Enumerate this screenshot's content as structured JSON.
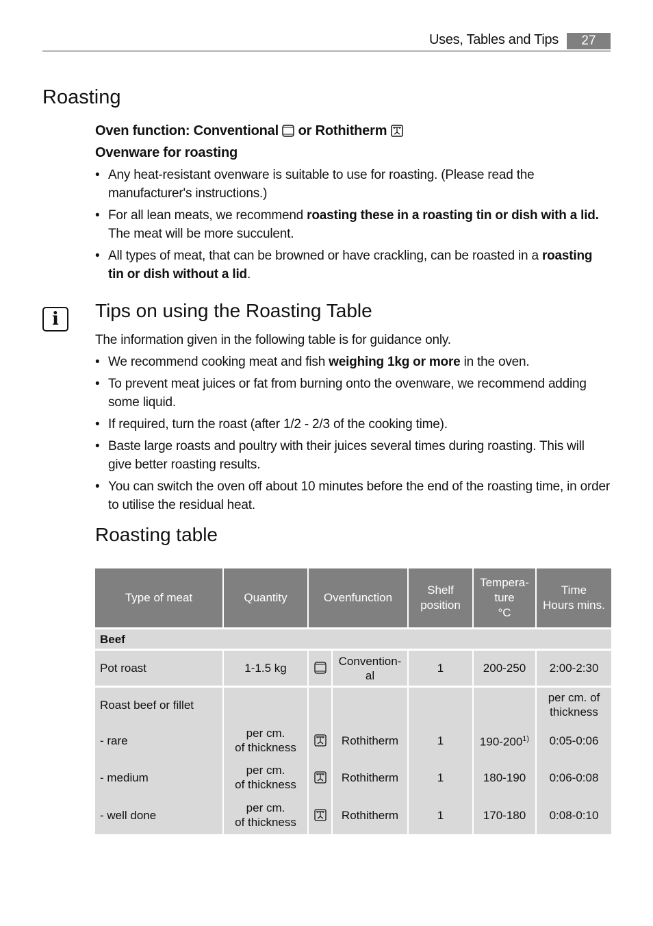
{
  "header": {
    "section": "Uses, Tables and Tips",
    "page": "27"
  },
  "roasting": {
    "title": "Roasting",
    "oven_function_prefix": "Oven function: Conventional",
    "oven_function_or": "or Rothitherm",
    "ovenware_title": "Ovenware for roasting",
    "b1": "Any heat-resistant ovenware is suitable to use for roasting. (Please read the manufacturer's instructions.)",
    "b2_a": "For all lean meats, we recommend ",
    "b2_b": "roasting these in a roasting tin or dish with a lid.",
    "b2_c": " The meat will be more succulent.",
    "b3_a": "All types of meat, that can be browned or have crackling, can be roasted in a ",
    "b3_b": "roasting tin or dish without a lid",
    "b3_c": "."
  },
  "tips": {
    "title": "Tips on using the Roasting Table",
    "intro": "The information given in the following table is for guidance only.",
    "b1_a": "We recommend cooking meat and fish ",
    "b1_b": "weighing 1kg or more",
    "b1_c": " in the oven.",
    "b2": "To prevent meat juices or fat from burning onto the ovenware, we recommend adding some liquid.",
    "b3": "If required, turn the roast (after 1/2 - 2/3 of the cooking time).",
    "b4": "Baste large roasts and poultry with their juices several times during roasting. This will give better roasting results.",
    "b5": "You can switch the oven off about 10 minutes before the end of the roasting time, in order to utilise the residual heat."
  },
  "table": {
    "title": "Roasting table",
    "headers": {
      "type": "Type of meat",
      "quantity": "Quantity",
      "function": "Ovenfunction",
      "shelf1": "Shelf",
      "shelf2": "position",
      "temp1": "Tempera-",
      "temp2": "ture",
      "temp3": "°C",
      "time1": "Time",
      "time2": "Hours mins."
    },
    "group": "Beef",
    "pot": {
      "type": "Pot roast",
      "qty": "1-1.5 kg",
      "icon": "conventional-icon",
      "func1": "Convention-",
      "func2": "al",
      "shelf": "1",
      "temp": "200-250",
      "time": "2:00-2:30"
    },
    "roast": {
      "type": "Roast beef or fillet",
      "time1": "per cm. of",
      "time2": "thickness"
    },
    "rows": [
      {
        "type": "- rare",
        "qty1": "per cm.",
        "qty2": "of thickness",
        "icon": "rothitherm-icon",
        "func": "Rothitherm",
        "shelf": "1",
        "temp": "190-200",
        "note": "1)",
        "time": "0:05-0:06"
      },
      {
        "type": "- medium",
        "qty1": "per cm.",
        "qty2": "of thickness",
        "icon": "rothitherm-icon",
        "func": "Rothitherm",
        "shelf": "1",
        "temp": "180-190",
        "time": "0:06-0:08"
      },
      {
        "type": "- well done",
        "qty1": "per cm.",
        "qty2": "of thickness",
        "icon": "rothitherm-icon",
        "func": "Rothitherm",
        "shelf": "1",
        "temp": "170-180",
        "time": "0:08-0:10"
      }
    ]
  },
  "colors": {
    "header_bg": "#808080",
    "cell_bg": "#d9d9d9"
  }
}
